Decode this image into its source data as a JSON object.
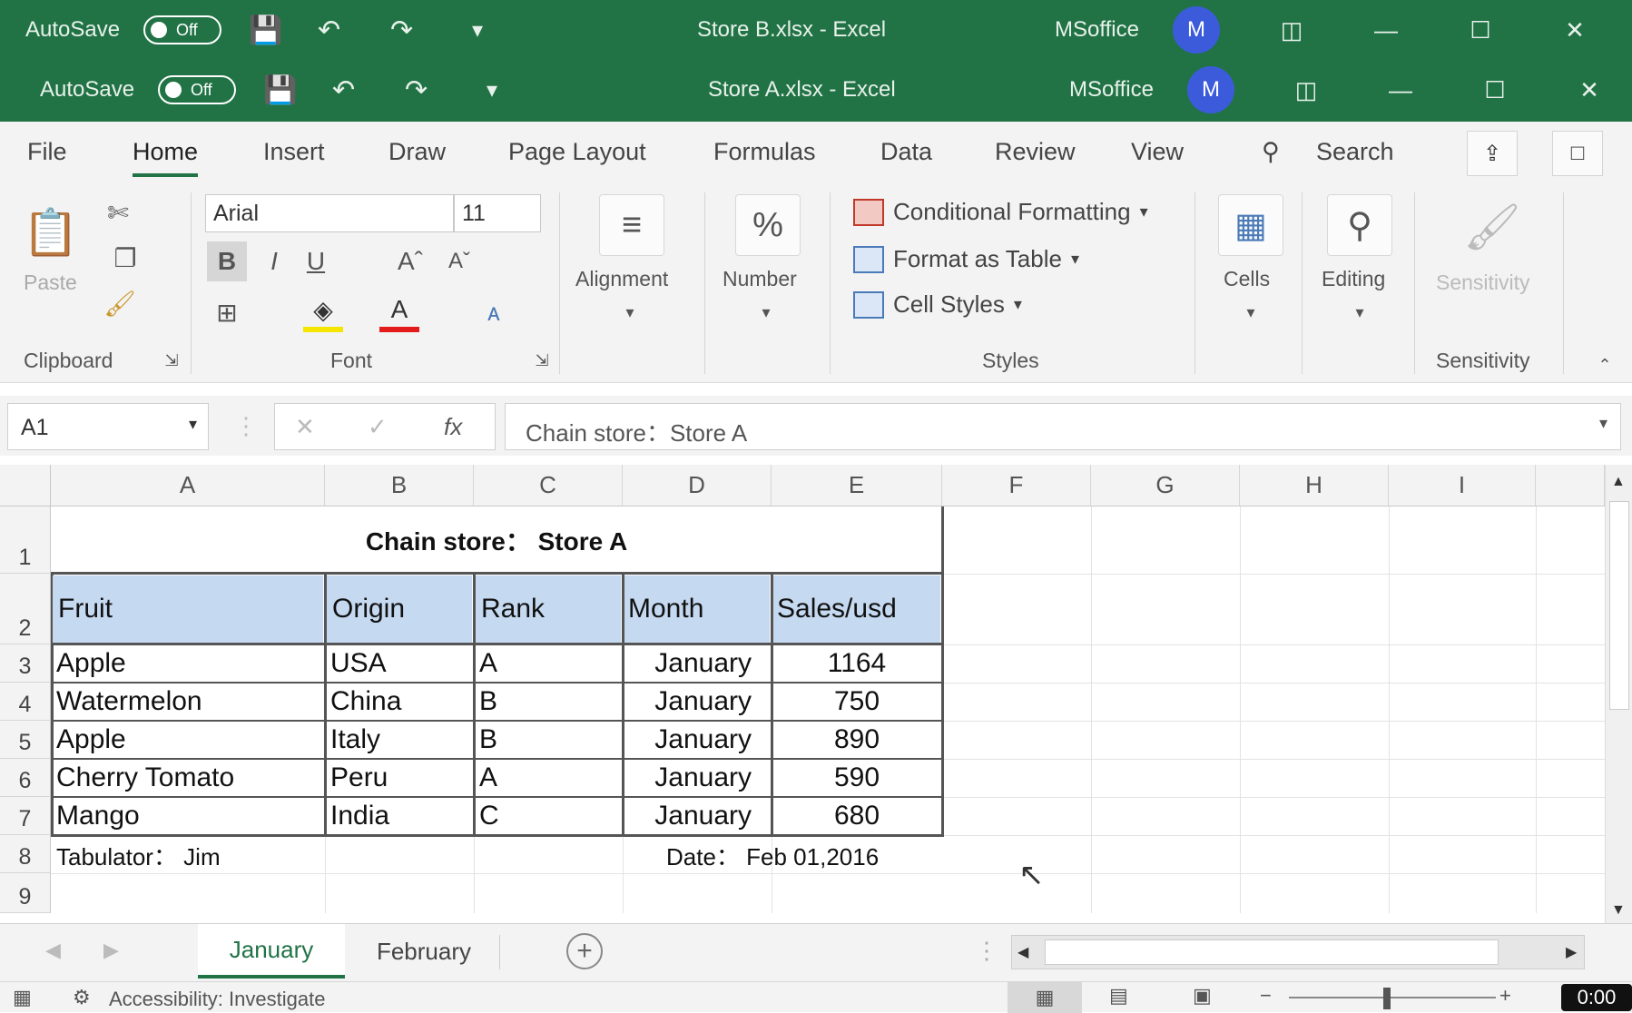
{
  "window_back": {
    "autosave_label": "AutoSave",
    "autosave_state": "Off",
    "title": "Store B.xlsx  -  Excel",
    "user": "MSoffice",
    "avatar_initial": "M"
  },
  "window_front": {
    "autosave_label": "AutoSave",
    "autosave_state": "Off",
    "title": "Store A.xlsx  -  Excel",
    "user": "MSoffice",
    "avatar_initial": "M"
  },
  "menu": {
    "tabs": [
      "File",
      "Home",
      "Insert",
      "Draw",
      "Page Layout",
      "Formulas",
      "Data",
      "Review",
      "View"
    ],
    "active": "Home",
    "search_label": "Search"
  },
  "ribbon": {
    "clipboard": {
      "paste_label": "Paste",
      "group_label": "Clipboard"
    },
    "font": {
      "font_name": "Arial",
      "font_size": "11",
      "bold": "B",
      "italic": "I",
      "underline": "U",
      "grow": "Aˆ",
      "shrink": "Aˇ",
      "font_color": "A",
      "group_label": "Font"
    },
    "alignment": {
      "label": "Alignment"
    },
    "number": {
      "label": "Number",
      "icon_glyph": "%"
    },
    "styles": {
      "conditional": "Conditional Formatting",
      "format_table": "Format as Table",
      "cell_styles": "Cell Styles",
      "group_label": "Styles"
    },
    "cells": {
      "label": "Cells"
    },
    "editing": {
      "label": "Editing"
    },
    "sensitivity": {
      "label": "Sensitivity",
      "group_label": "Sensitivity"
    }
  },
  "formula_bar": {
    "name_box": "A1",
    "fx": "fx",
    "content": "Chain store：Store A"
  },
  "sheet": {
    "columns": [
      "A",
      "B",
      "C",
      "D",
      "E",
      "F",
      "G",
      "H",
      "I"
    ],
    "rows": [
      "1",
      "2",
      "3",
      "4",
      "5",
      "6",
      "7",
      "8",
      "9"
    ],
    "title": "Chain store： Store A",
    "headers": [
      "Fruit",
      "Origin",
      "Rank",
      "Month",
      "Sales/usd"
    ],
    "data": [
      [
        "Apple",
        "USA",
        "A",
        "January",
        "1164"
      ],
      [
        "Watermelon",
        "China",
        "B",
        "January",
        "750"
      ],
      [
        "Apple",
        "Italy",
        "B",
        "January",
        "890"
      ],
      [
        "Cherry Tomato",
        "Peru",
        "A",
        "January",
        "590"
      ],
      [
        "Mango",
        "India",
        "C",
        "January",
        "680"
      ]
    ],
    "tabulator": "Tabulator： Jim",
    "date": "Date： Feb 01,2016"
  },
  "sheet_tabs": {
    "tabs": [
      "January",
      "February"
    ],
    "active": "January"
  },
  "status": {
    "accessibility": "Accessibility: Investigate",
    "time": "0:00"
  }
}
